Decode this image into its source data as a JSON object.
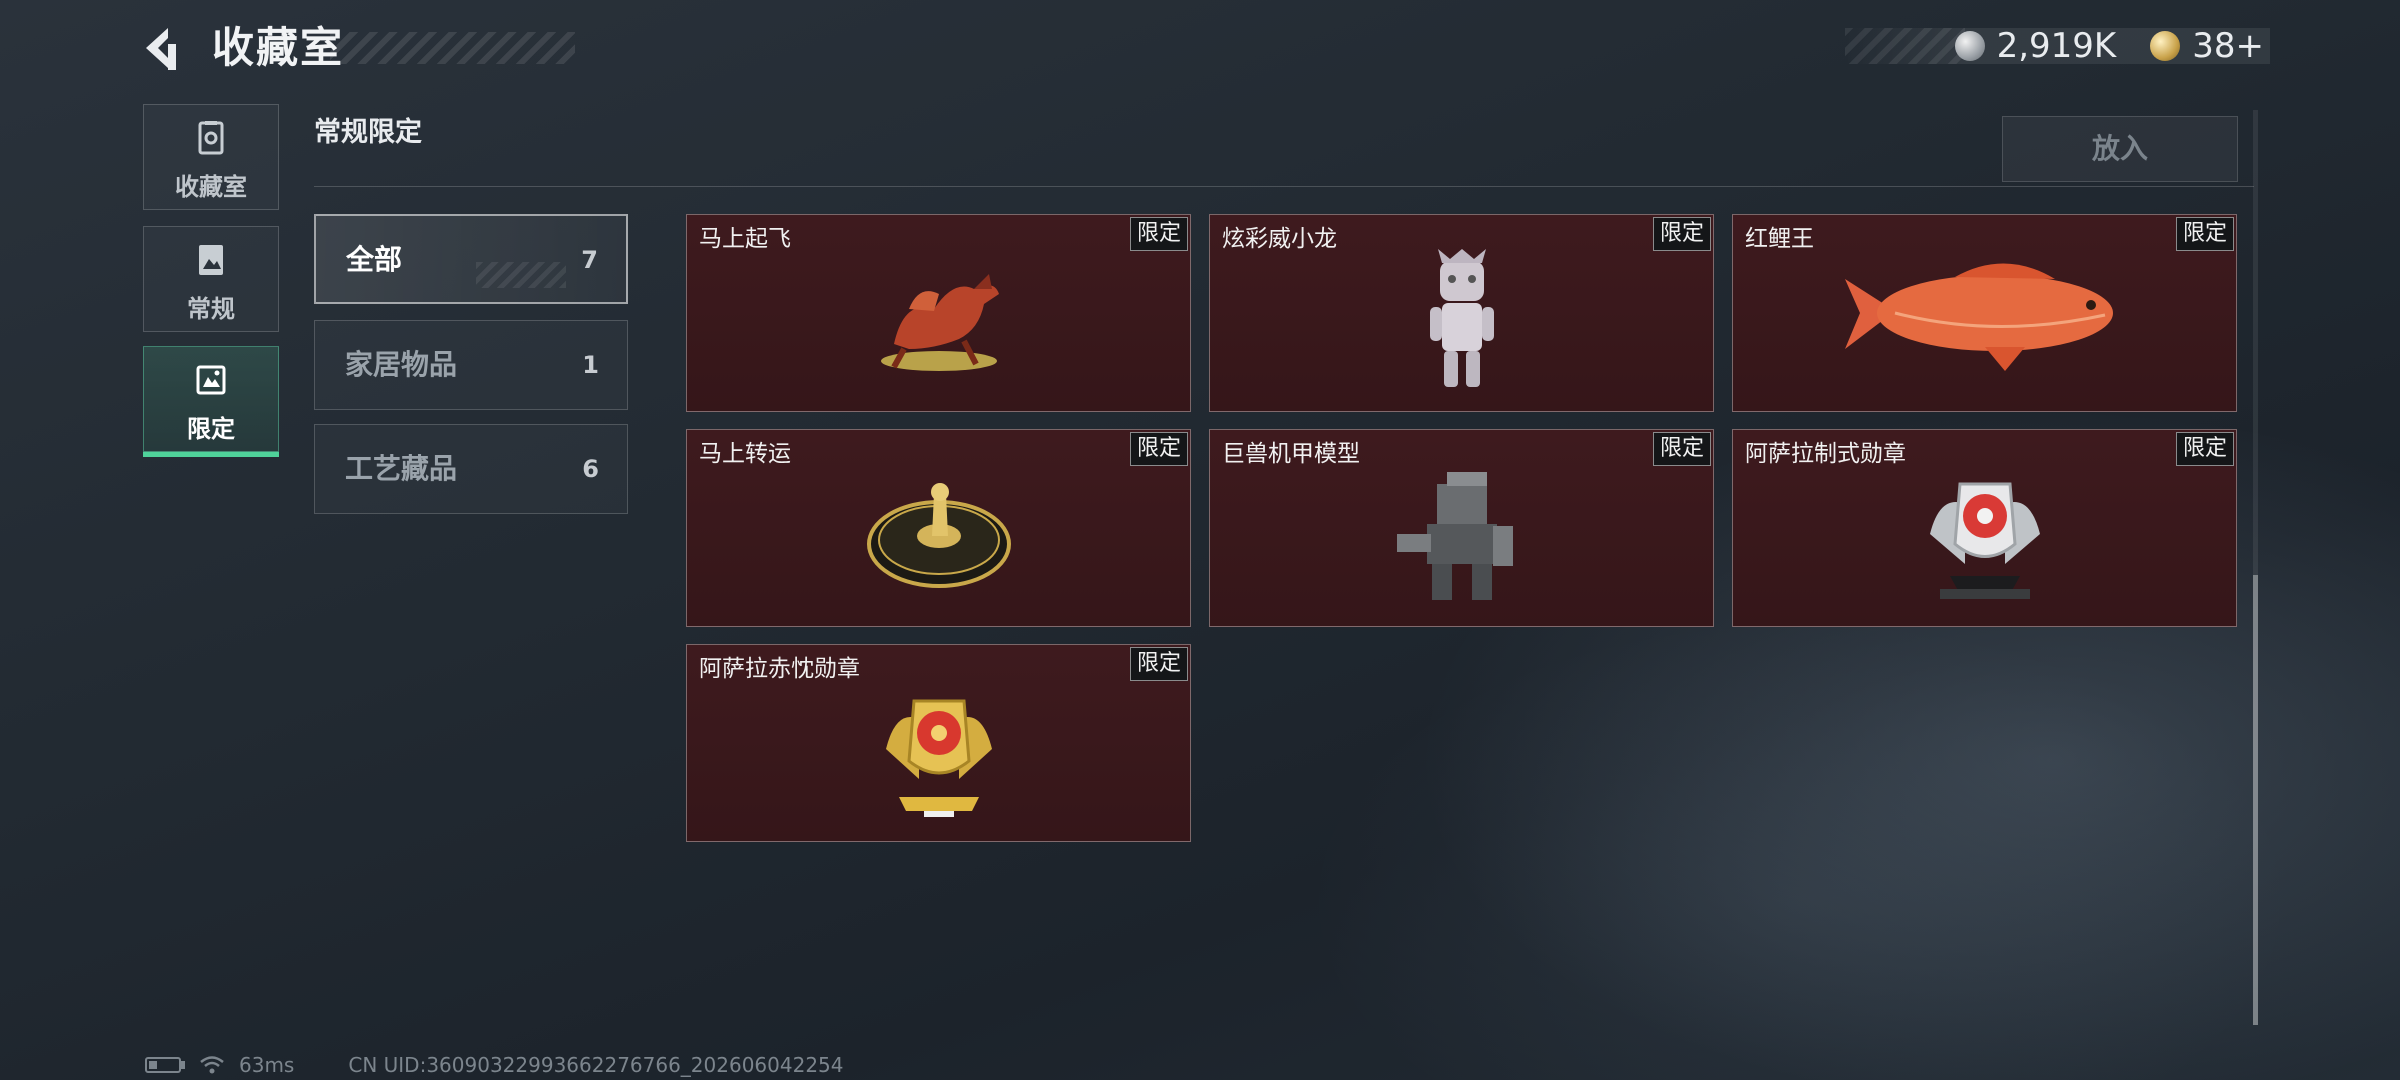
{
  "header": {
    "title": "收藏室",
    "currency": [
      {
        "icon": "silver-coin-icon",
        "value": "2,919K"
      },
      {
        "icon": "gold-coin-icon",
        "value": "38+"
      }
    ]
  },
  "sidebar": {
    "items": [
      {
        "label": "收藏室",
        "icon": "collection-icon",
        "active": false
      },
      {
        "label": "常规",
        "icon": "regular-icon",
        "active": false
      },
      {
        "label": "限定",
        "icon": "limited-icon",
        "active": true
      }
    ]
  },
  "section": {
    "title": "常规限定",
    "put_button": "放入"
  },
  "categories": [
    {
      "name": "全部",
      "count": "7",
      "active": true
    },
    {
      "name": "家居物品",
      "count": "1",
      "active": false
    },
    {
      "name": "工艺藏品",
      "count": "6",
      "active": false
    }
  ],
  "items": [
    {
      "name": "马上起飞",
      "tag": "限定",
      "art": "horse-figure"
    },
    {
      "name": "炫彩威小龙",
      "tag": "限定",
      "art": "dragon-figure"
    },
    {
      "name": "红鲤王",
      "tag": "限定",
      "art": "red-carp"
    },
    {
      "name": "马上转运",
      "tag": "限定",
      "art": "fortune-wheel"
    },
    {
      "name": "巨兽机甲模型",
      "tag": "限定",
      "art": "mech-model"
    },
    {
      "name": "阿萨拉制式勋章",
      "tag": "限定",
      "art": "silver-medal"
    },
    {
      "name": "阿萨拉赤忱勋章",
      "tag": "限定",
      "art": "gold-medal"
    }
  ],
  "status_bar": {
    "ping": "63ms",
    "uid": "CN UID:36090322993662276766_202606042254"
  },
  "colors": {
    "accent": "#4fd29a",
    "card_bg": "#3a181b",
    "tag_bg": "#141618"
  }
}
